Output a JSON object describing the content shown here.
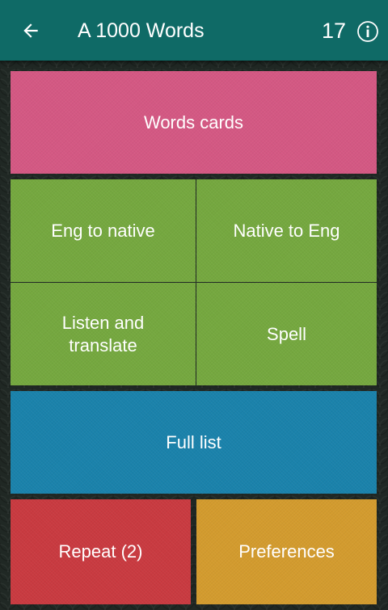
{
  "app_bar": {
    "title": "A 1000 Words",
    "count": "17",
    "back_icon": "arrow-left-icon",
    "info_icon": "info-circle-icon",
    "color": "#0f6a66"
  },
  "tiles": {
    "words_cards": {
      "label": "Words cards",
      "color": "#d45883"
    },
    "eng_to_native": {
      "label": "Eng to native",
      "color": "#75a83f"
    },
    "native_to_eng": {
      "label": "Native to Eng",
      "color": "#75a83f"
    },
    "listen_and_translate": {
      "label_line1": "Listen and",
      "label_line2": "translate",
      "color": "#75a83f"
    },
    "spell": {
      "label": "Spell",
      "color": "#75a83f"
    },
    "full_list": {
      "label": "Full list",
      "color": "#1a82ab"
    },
    "repeat": {
      "label": "Repeat (2)",
      "color": "#c93a40"
    },
    "preferences": {
      "label": "Preferences",
      "color": "#d39b2e"
    }
  }
}
